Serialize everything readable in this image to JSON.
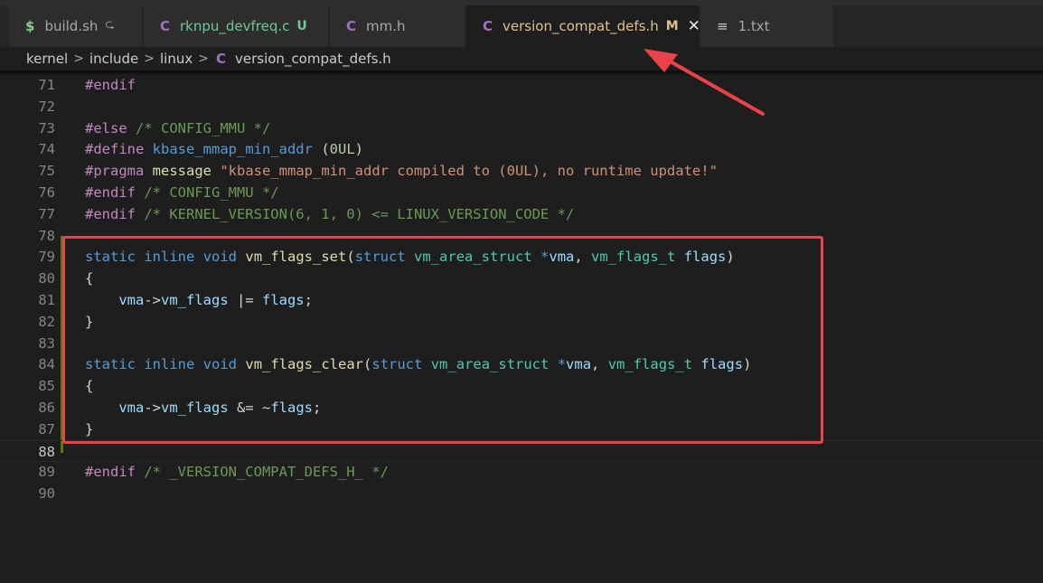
{
  "tabs": [
    {
      "icon": "$",
      "icon_name": "shell-file-icon",
      "label": "build.sh",
      "status": "⮎",
      "active": false
    },
    {
      "icon": "C",
      "icon_name": "c-file-icon",
      "label": "rknpu_devfreq.c",
      "status": "U",
      "active": false
    },
    {
      "icon": "C",
      "icon_name": "c-file-icon",
      "label": "mm.h",
      "status": "",
      "active": false
    },
    {
      "icon": "C",
      "icon_name": "c-file-icon",
      "label": "version_compat_defs.h",
      "status": "M",
      "active": true,
      "close": "✕"
    },
    {
      "icon": "≡",
      "icon_name": "text-file-icon",
      "label": "1.txt",
      "status": "",
      "active": false
    }
  ],
  "breadcrumb": {
    "items": [
      "kernel",
      "include",
      "linux",
      "version_compat_defs.h"
    ],
    "separator": ">",
    "file_icon": "C"
  },
  "editor": {
    "current_line": 88,
    "lines": [
      {
        "n": "71",
        "code": "#endif"
      },
      {
        "n": "72",
        "code": ""
      },
      {
        "n": "73",
        "code": "#else /* CONFIG_MMU */"
      },
      {
        "n": "74",
        "code": "#define kbase_mmap_min_addr (0UL)"
      },
      {
        "n": "75",
        "code": "#pragma message \"kbase_mmap_min_addr compiled to (0UL), no runtime update!\""
      },
      {
        "n": "76",
        "code": "#endif /* CONFIG_MMU */"
      },
      {
        "n": "77",
        "code": "#endif /* KERNEL_VERSION(6, 1, 0) <= LINUX_VERSION_CODE */"
      },
      {
        "n": "78",
        "code": ""
      },
      {
        "n": "79",
        "code": "static inline void vm_flags_set(struct vm_area_struct *vma, vm_flags_t flags)"
      },
      {
        "n": "80",
        "code": "{"
      },
      {
        "n": "81",
        "code": "    vma->vm_flags |= flags;"
      },
      {
        "n": "82",
        "code": "}"
      },
      {
        "n": "83",
        "code": ""
      },
      {
        "n": "84",
        "code": "static inline void vm_flags_clear(struct vm_area_struct *vma, vm_flags_t flags)"
      },
      {
        "n": "85",
        "code": "{"
      },
      {
        "n": "86",
        "code": "    vma->vm_flags &= ~flags;"
      },
      {
        "n": "87",
        "code": "}"
      },
      {
        "n": "88",
        "code": ""
      },
      {
        "n": "89",
        "code": "#endif /* _VERSION_COMPAT_DEFS_H_ */"
      },
      {
        "n": "90",
        "code": ""
      }
    ]
  },
  "colors": {
    "annotation": "#e8434a",
    "keyword": "#569cd6",
    "function": "#dcdcaa",
    "type": "#4ec9b0",
    "variable": "#9cdcfe",
    "comment": "#6a9955",
    "directive": "#c586c0",
    "string": "#ce9178"
  }
}
